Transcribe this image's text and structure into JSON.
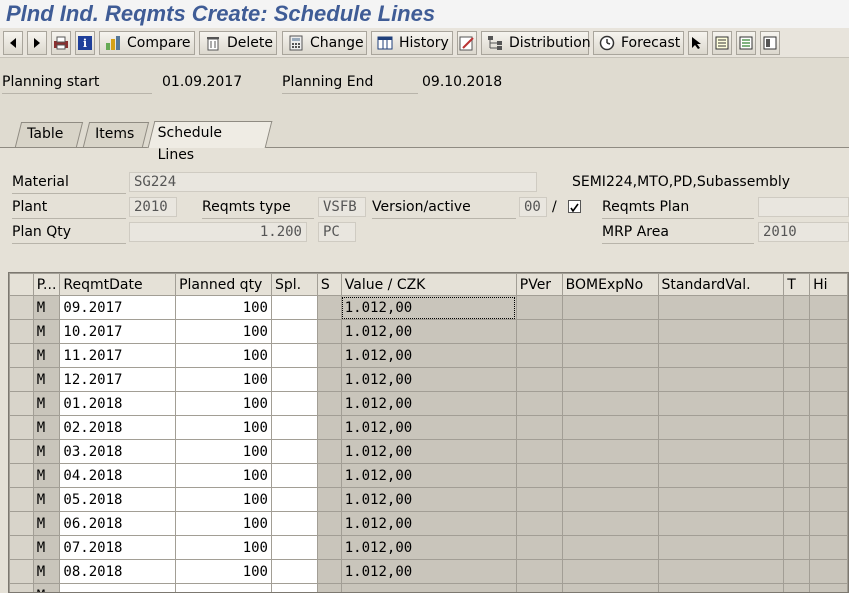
{
  "window": {
    "title": "Plnd Ind. Reqmts Create: Schedule Lines"
  },
  "toolbar": {
    "compare": "Compare",
    "delete": "Delete",
    "change": "Change",
    "history": "History",
    "distribution": "Distribution",
    "forecast": "Forecast"
  },
  "header": {
    "planning_start_label": "Planning start",
    "planning_start": "01.09.2017",
    "planning_end_label": "Planning End",
    "planning_end": "09.10.2018"
  },
  "tabs": [
    "Table",
    "Items",
    "Schedule Lines"
  ],
  "detail": {
    "material_label": "Material",
    "material": "SG224",
    "material_desc": "SEMI224,MTO,PD,Subassembly",
    "plant_label": "Plant",
    "plant": "2010",
    "reqmts_type_label": "Reqmts type",
    "reqmts_type": "VSFB",
    "version_label": "Version/active",
    "version": "00",
    "version_sep": "/",
    "reqmts_plan_label": "Reqmts Plan",
    "reqmts_plan": "",
    "plan_qty_label": "Plan Qty",
    "plan_qty": "1.200",
    "uom": "PC",
    "mrp_area_label": "MRP Area",
    "mrp_area": "2010"
  },
  "grid": {
    "headers": [
      "P...",
      "ReqmtDate",
      "Planned qty",
      "Spl.",
      "S",
      "Value   / CZK",
      "PVer",
      "BOMExpNo",
      "StandardVal.",
      "T",
      "Hi"
    ],
    "rows": [
      [
        "M",
        "09.2017",
        "100",
        "1.012,00"
      ],
      [
        "M",
        "10.2017",
        "100",
        "1.012,00"
      ],
      [
        "M",
        "11.2017",
        "100",
        "1.012,00"
      ],
      [
        "M",
        "12.2017",
        "100",
        "1.012,00"
      ],
      [
        "M",
        "01.2018",
        "100",
        "1.012,00"
      ],
      [
        "M",
        "02.2018",
        "100",
        "1.012,00"
      ],
      [
        "M",
        "03.2018",
        "100",
        "1.012,00"
      ],
      [
        "M",
        "04.2018",
        "100",
        "1.012,00"
      ],
      [
        "M",
        "05.2018",
        "100",
        "1.012,00"
      ],
      [
        "M",
        "06.2018",
        "100",
        "1.012,00"
      ],
      [
        "M",
        "07.2018",
        "100",
        "1.012,00"
      ],
      [
        "M",
        "08.2018",
        "100",
        "1.012,00"
      ],
      [
        "M",
        "",
        "",
        ""
      ]
    ]
  },
  "colors": {
    "title": "#3f5c96",
    "background": "#dfdbd0"
  }
}
